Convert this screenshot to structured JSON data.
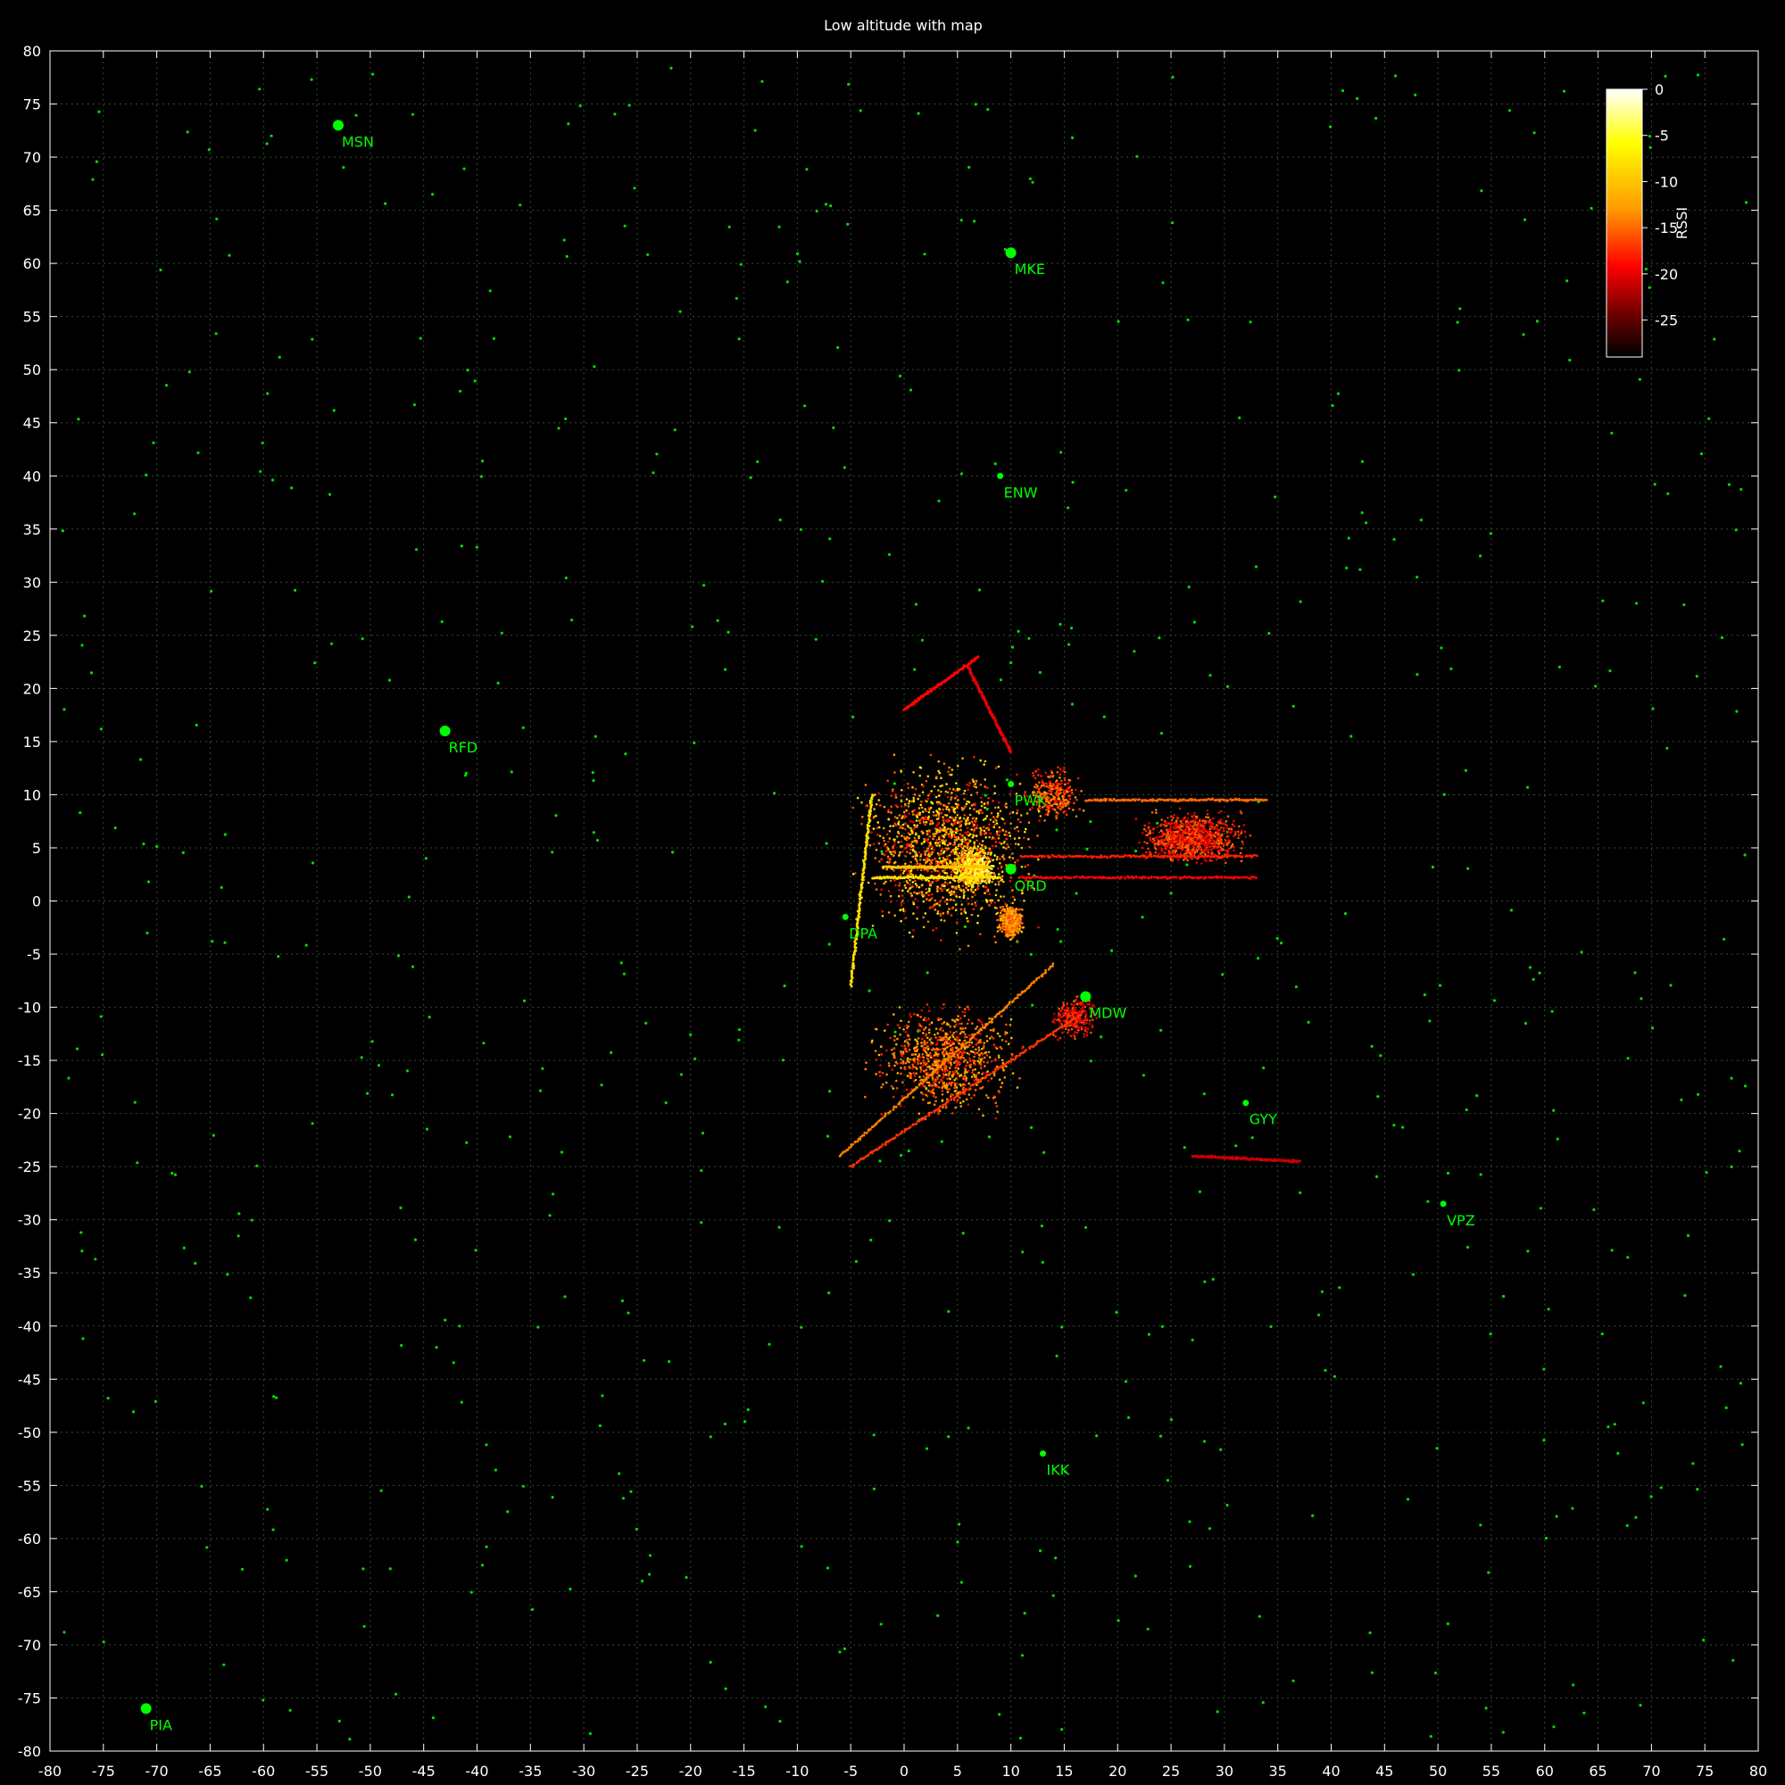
{
  "chart_data": {
    "type": "scatter",
    "title": "Low altitude with map",
    "xlabel": "",
    "ylabel": "",
    "xlim": [
      -80,
      80
    ],
    "ylim": [
      -80,
      80
    ],
    "x_ticks": [
      -80,
      -75,
      -70,
      -65,
      -60,
      -55,
      -50,
      -45,
      -40,
      -35,
      -30,
      -25,
      -20,
      -15,
      -10,
      -5,
      0,
      5,
      10,
      15,
      20,
      25,
      30,
      35,
      40,
      45,
      50,
      55,
      60,
      65,
      70,
      75,
      80
    ],
    "y_ticks": [
      80,
      75,
      70,
      65,
      60,
      55,
      50,
      45,
      40,
      35,
      30,
      25,
      20,
      15,
      10,
      5,
      0,
      -5,
      -10,
      -15,
      -20,
      -25,
      -30,
      -35,
      -40,
      -45,
      -50,
      -55,
      -60,
      -65,
      -70,
      -75,
      -80
    ],
    "grid": true,
    "colorbar": {
      "label": "RSSI",
      "range": [
        -29,
        0
      ],
      "ticks": [
        0,
        -5,
        -10,
        -15,
        -20,
        -25
      ],
      "placement": "top-right"
    },
    "airports": [
      {
        "code": "MSN",
        "x": -53,
        "y": 73,
        "size": "large"
      },
      {
        "code": "MKE",
        "x": 10,
        "y": 61,
        "size": "large"
      },
      {
        "code": "ENW",
        "x": 9,
        "y": 40,
        "size": "small"
      },
      {
        "code": "RFD",
        "x": -43,
        "y": 16,
        "size": "large"
      },
      {
        "code": "PWK",
        "x": 10,
        "y": 11,
        "size": "small"
      },
      {
        "code": "ORD",
        "x": 10,
        "y": 3,
        "size": "large"
      },
      {
        "code": "DPA",
        "x": -5.5,
        "y": -1.5,
        "size": "small"
      },
      {
        "code": "MDW",
        "x": 17,
        "y": -9,
        "size": "large"
      },
      {
        "code": "GYY",
        "x": 32,
        "y": -19,
        "size": "small"
      },
      {
        "code": "VPZ",
        "x": 50.5,
        "y": -28.5,
        "size": "small"
      },
      {
        "code": "IKK",
        "x": 13,
        "y": -52,
        "size": "small"
      },
      {
        "code": "PIA",
        "x": -71,
        "y": -76,
        "size": "large"
      }
    ],
    "track_lines": [
      {
        "name": "westbound-arrivals",
        "x": [
          -3,
          9
        ],
        "y": [
          2.2,
          2.2
        ],
        "rssi": -8
      },
      {
        "name": "westbound-arrivals-2",
        "x": [
          -2,
          8
        ],
        "y": [
          3.2,
          3.2
        ],
        "rssi": -10
      },
      {
        "name": "east-approach-1",
        "x": [
          11,
          33
        ],
        "y": [
          4.2,
          4.2
        ],
        "rssi": -18
      },
      {
        "name": "east-approach-2",
        "x": [
          11,
          33
        ],
        "y": [
          2.2,
          2.2
        ],
        "rssi": -19
      },
      {
        "name": "east-approach-3",
        "x": [
          17,
          34
        ],
        "y": [
          9.5,
          9.5
        ],
        "rssi": -15
      },
      {
        "name": "dpa-final",
        "x": [
          -3,
          -5
        ],
        "y": [
          10,
          -8
        ],
        "rssi": -8
      },
      {
        "name": "mdw-sw-1",
        "x": [
          -6,
          14
        ],
        "y": [
          -24,
          -6
        ],
        "rssi": -14
      },
      {
        "name": "mdw-sw-2",
        "x": [
          -5,
          16
        ],
        "y": [
          -25,
          -11
        ],
        "rssi": -17
      },
      {
        "name": "north-arc",
        "x": [
          6,
          10
        ],
        "y": [
          22,
          14
        ],
        "rssi": -20
      },
      {
        "name": "northwest-1",
        "x": [
          0,
          7
        ],
        "y": [
          18,
          23
        ],
        "rssi": -19
      },
      {
        "name": "far-east-1",
        "x": [
          27,
          37
        ],
        "y": [
          -24,
          -24.5
        ],
        "rssi": -21
      }
    ]
  }
}
